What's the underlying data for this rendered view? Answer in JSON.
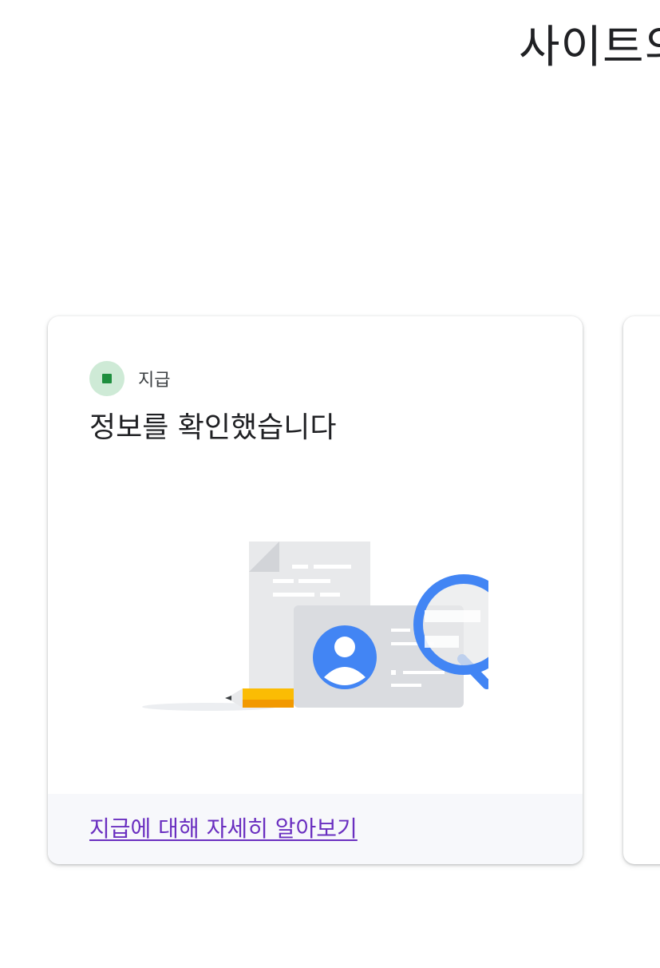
{
  "header": {
    "title": "사이트의"
  },
  "card": {
    "status": {
      "label": "지급",
      "icon": "green-status-dot-icon",
      "dot_color": "#ceead6",
      "square_color": "#1e8e3e"
    },
    "headline": "정보를 확인했습니다",
    "illustration": "document-id-card-magnifier-illustration",
    "footer": {
      "link_label": "지급에 대해 자세히 알아보기",
      "link_color": "#6a2fc0",
      "background": "#f7f8fb"
    }
  }
}
